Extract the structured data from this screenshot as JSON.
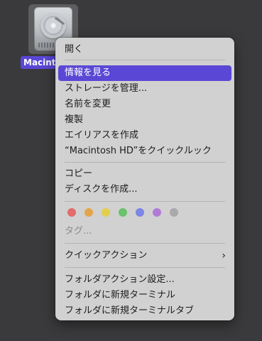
{
  "desktop": {
    "icon_label": "Macintosh HD"
  },
  "menu": {
    "open": "開く",
    "get_info": "情報を見る",
    "manage_storage": "ストレージを管理...",
    "rename": "名前を変更",
    "duplicate": "複製",
    "make_alias": "エイリアスを作成",
    "quick_look": "“Macintosh HD”をクイックルック",
    "copy": "コピー",
    "create_disk_image": "ディスクを作成...",
    "tags": "タグ...",
    "quick_actions": "クイックアクション",
    "folder_actions": "フォルダアクション設定...",
    "new_terminal": "フォルダに新規ターミナル",
    "new_terminal_tab": "フォルダに新規ターミナルタブ"
  },
  "tag_colors": [
    "#e26b6b",
    "#e4a44a",
    "#e4cf4a",
    "#6ac26a",
    "#7b86e6",
    "#b07bd6",
    "#a9a9a9"
  ],
  "colors": {
    "highlight": "#5a47d6",
    "menu_bg": "#d1d1d1",
    "desktop_bg": "#3a3a3c"
  }
}
